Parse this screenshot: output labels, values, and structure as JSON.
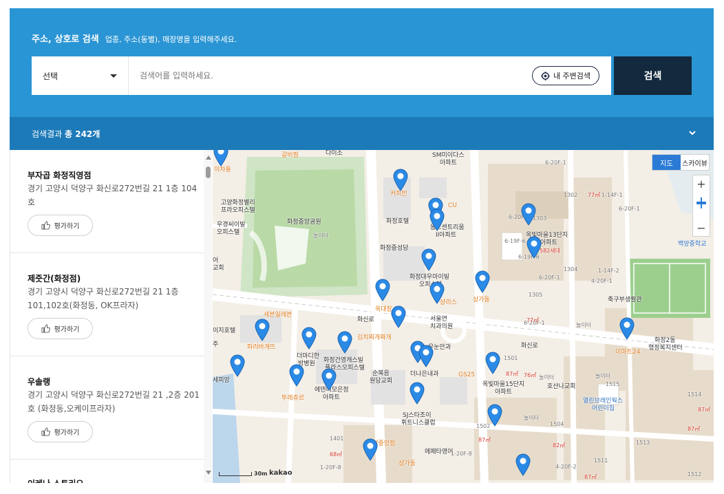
{
  "header": {
    "title": "주소, 상호로 검색",
    "subtitle": "업종, 주소(동별), 매장명을 입력해주세요.",
    "select_label": "선택",
    "search_placeholder": "검색어를 입력하세요.",
    "nearby_label": "내 주변검색",
    "search_button": "검색"
  },
  "results": {
    "prefix": "검색결과",
    "count_text": "총 242개"
  },
  "list": {
    "items": [
      {
        "name": "부자곱 화정직영점",
        "address": "경기 고양시 덕양구 화신로272번길 21 1층 104호",
        "rate_label": "평가하기"
      },
      {
        "name": "제줏간(화정점)",
        "address": "경기 고양시 덕양구 화신로272번길 21 1층 101,102호(화정동, OK프라자)",
        "rate_label": "평가하기"
      },
      {
        "name": "우솔랭",
        "address": "경기 고양시 덕양구 화신로272번길 21 ,2층 201호 (화정동,오케이프라자)",
        "rate_label": "평가하기"
      },
      {
        "name": "이레나 스토리오",
        "address": "",
        "rate_label": ""
      }
    ]
  },
  "map": {
    "type_map": "지도",
    "type_sky": "스카이뷰",
    "zoom_in": "+",
    "zoom_out": "−",
    "scale": "30m",
    "logo": "kakao",
    "labels": {
      "l01": "이차돌",
      "l02": "갈비찜",
      "l03": "다이소",
      "l04": "SM미이다스",
      "l05": "아파트",
      "l06": "6-20F-1",
      "l07": "고양화정별리",
      "l08": "프라오피스텔",
      "l09": "화정중앙공원",
      "l10": "우경씨이빌",
      "l11": "오피스텔",
      "l12": "놀이터",
      "l13": "커피빈",
      "l14": "화정호텔",
      "l15": "CU",
      "l16": "동도센트리움",
      "l17": "II아파트",
      "l18": "화정중성당",
      "l19": "1303",
      "l20": "옥빛마을13단지",
      "l21": "아파트",
      "l22": "582세대",
      "l23": "백양중학교",
      "l24": "화정대우마이빌",
      "l25": "오피스텔",
      "l26": "1305",
      "l27": "샹리스",
      "l28": "상가동",
      "l29": "옥대장",
      "l30": "서울연",
      "l31": "치과의원",
      "l32": "축구부생활관",
      "l33": "6-20F-1",
      "l34": "놀이터",
      "l35": "세븐일레븐",
      "l36": "이지호텔",
      "l37": "파리바게뜨",
      "l38": "김치찌개짜개",
      "l39": "화신로",
      "l40": "화정2동",
      "l41": "행정복지센터",
      "l42": "이마트24",
      "l43": "더마디한",
      "l44": "방병원",
      "l45": "화정건영캐스빌",
      "l46": "플라스오피스텔",
      "l47": "우눈안과",
      "l48": "1501",
      "l49": "세피앙",
      "l50": "순복음",
      "l51": "원당교회",
      "l52": "더나은내과",
      "l53": "GS25",
      "l54": "옥빛마을15단지",
      "l55": "아파트",
      "l56": "놀이터",
      "l57": "호산나교회",
      "l58": "놀이터",
      "l59": "1515",
      "l60": "뚜레쥬르",
      "l61": "에덴디모은정",
      "l62": "아파트",
      "l63": "SJ스타조이",
      "l64": "휘트니스클럽",
      "l65": "열린브레인웍스",
      "l66": "어린이집",
      "l67": "1514",
      "l68": "1502",
      "l69": "놀이터",
      "l70": "1504",
      "l71": "1401",
      "l72": "화정중앙점",
      "l73": "에페타영어",
      "l74": "1-20F-8",
      "l75": "상가동",
      "l76": "1511",
      "l77": "1512",
      "l78": "1513",
      "l79": "1-20F-8",
      "l80": "6-20F-1",
      "l81": "화신로",
      "l82": "어",
      "l83": "교회",
      "l84": "주",
      "l85": "1302",
      "l86": "1304",
      "l87": "6-19F-6",
      "l88": "6-19F-6",
      "l89": "4-20F-2",
      "l90": "4-20F-1",
      "l91": "1-14F-1",
      "l92": "1-14F-2",
      "l93": "6-20F-1",
      "l94": "6-20F-1",
      "l95": "77㎡",
      "l96": "87㎡",
      "l97": "76㎡",
      "l98": "87㎡",
      "l99": "87㎡",
      "l100": "68㎡",
      "l101": "82㎡",
      "l102": "87㎡",
      "l103": "87㎡",
      "l104": "77㎡"
    }
  },
  "colors": {
    "header_bg": "#2a95d4",
    "result_bar_bg": "#1d7ab8",
    "search_button_bg": "#13293d",
    "pin_blue": "#2b8ae6",
    "park_green": "#cfe5c5",
    "field_green": "#9ccf8e",
    "water_blue": "#bcd6ec"
  }
}
